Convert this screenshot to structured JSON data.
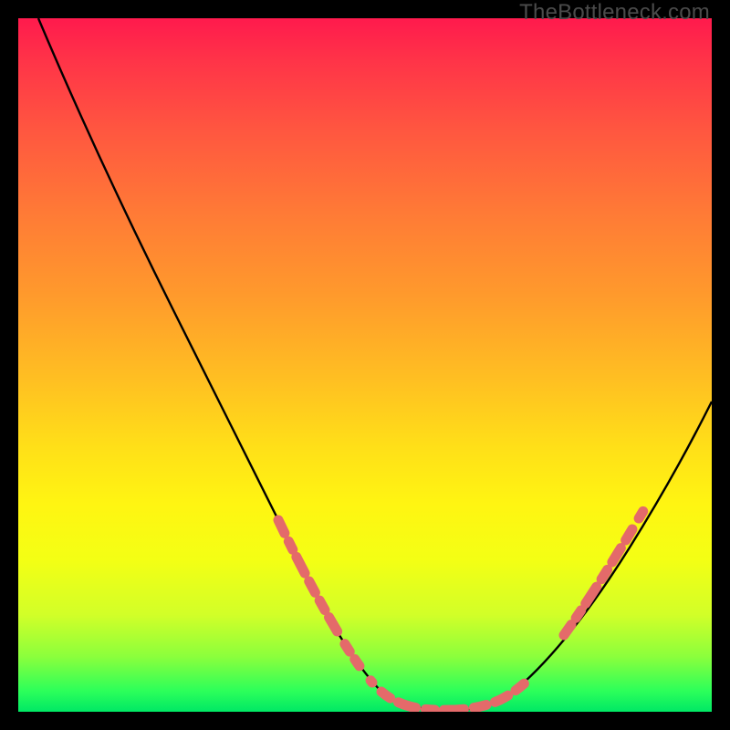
{
  "watermark": "TheBottleneck.com",
  "chart_data": {
    "type": "line",
    "title": "",
    "xlabel": "",
    "ylabel": "",
    "xlim": [
      0,
      100
    ],
    "ylim": [
      0,
      100
    ],
    "series": [
      {
        "name": "curve",
        "x": [
          3,
          10,
          20,
          30,
          38,
          44,
          48,
          52,
          56,
          60,
          64,
          68,
          72,
          78,
          86,
          94,
          100
        ],
        "y": [
          100,
          86,
          68,
          48,
          32,
          20,
          12,
          6,
          2,
          0,
          0,
          0,
          2,
          8,
          22,
          40,
          56
        ]
      }
    ],
    "highlight_segments": {
      "left": {
        "x_range": [
          38,
          48
        ],
        "description": "dashed salmon segment on left descent"
      },
      "bottom": {
        "x_range": [
          52,
          70
        ],
        "description": "dashed salmon segment across valley floor"
      },
      "right": {
        "x_range": [
          76,
          86
        ],
        "description": "dashed salmon segment on right ascent"
      }
    },
    "colors": {
      "curve": "#000000",
      "highlight": "#e46a6a",
      "background_top": "#ff1a4d",
      "background_bottom": "#00e865",
      "frame": "#000000"
    }
  }
}
